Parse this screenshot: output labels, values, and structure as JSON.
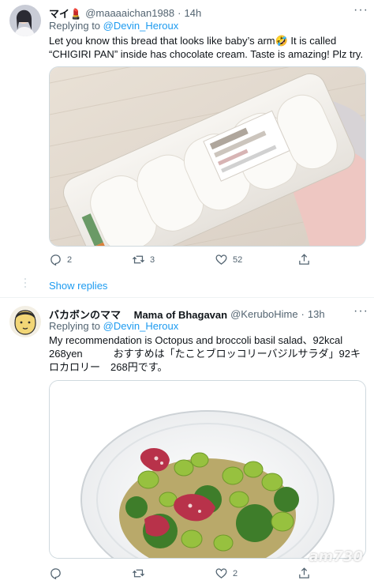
{
  "tweets": [
    {
      "display_name": "マイ💄",
      "handle": "@maaaaichan1988",
      "separator": "·",
      "time": "14h",
      "more": "···",
      "replying_prefix": "Replying to",
      "replying_to": "@Devin_Heroux",
      "text": "Let you know this bread that looks like baby’s arm🤣 It is called “CHIGIRI PAN” inside has chocolate cream. Taste is amazing! Plz try.",
      "image_icon": "bread-photo-icon",
      "stats": {
        "replies": "2",
        "retweets": "3",
        "likes": "52"
      }
    },
    {
      "display_name": "バカボンのママ　 Mama of Bhagavan",
      "handle": "@KeruboHime",
      "separator": "·",
      "time": "13h",
      "more": "···",
      "replying_prefix": "Replying to",
      "replying_to": "@Devin_Heroux",
      "text": "My recommendation is Octopus and broccoli basil salad、92kcal 268yen　　　おすすめは「たことブロッコリーバジルサラダ」92キロカロリー　268円です。",
      "image_icon": "salad-photo-icon",
      "stats": {
        "replies": "",
        "retweets": "",
        "likes": "2"
      }
    }
  ],
  "show_replies": "Show replies",
  "watermark": "am730",
  "colors": {
    "accent": "#1d9bf0",
    "muted": "#536471",
    "text": "#0f1419",
    "border": "#cfd9de"
  }
}
